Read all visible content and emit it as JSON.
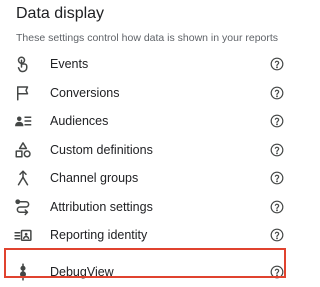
{
  "section": {
    "title": "Data display",
    "subtitle": "These settings control how data is shown in your reports"
  },
  "items": [
    {
      "label": "Events",
      "icon": "touch-icon"
    },
    {
      "label": "Conversions",
      "icon": "flag-icon"
    },
    {
      "label": "Audiences",
      "icon": "audience-list-icon"
    },
    {
      "label": "Custom definitions",
      "icon": "shapes-icon"
    },
    {
      "label": "Channel groups",
      "icon": "merge-icon"
    },
    {
      "label": "Attribution settings",
      "icon": "route-icon"
    },
    {
      "label": "Reporting identity",
      "icon": "identity-icon"
    },
    {
      "label": "DebugView",
      "icon": "debug-icon"
    }
  ],
  "colors": {
    "text": "#202124",
    "secondary_text": "#5f6368",
    "icon": "#444746",
    "highlight": "#e0432f"
  }
}
